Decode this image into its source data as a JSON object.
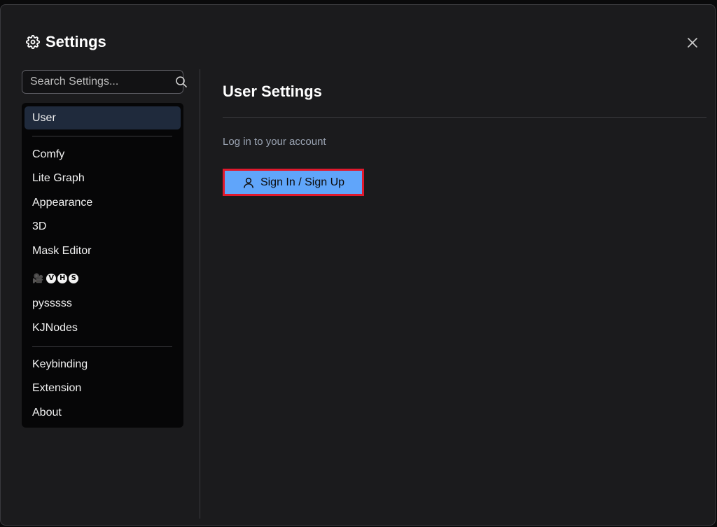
{
  "header": {
    "title": "Settings",
    "icon": "gear-icon",
    "close_icon": "close-icon"
  },
  "search": {
    "placeholder": "Search Settings...",
    "value": "",
    "icon": "search-icon"
  },
  "nav": {
    "items": [
      {
        "label": "User",
        "active": true
      },
      {
        "label": "Comfy"
      },
      {
        "label": "Lite Graph"
      },
      {
        "label": "Appearance"
      },
      {
        "label": "3D"
      },
      {
        "label": "Mask Editor"
      },
      {
        "label": "🎥VHS",
        "emoji": "🎥",
        "letters": [
          "V",
          "H",
          "S"
        ]
      },
      {
        "label": "pysssss"
      },
      {
        "label": "KJNodes"
      },
      {
        "label": "Keybinding"
      },
      {
        "label": "Extension"
      },
      {
        "label": "About"
      }
    ]
  },
  "panel": {
    "title": "User Settings",
    "login_prompt": "Log in to your account",
    "signin_label": "Sign In / Sign Up",
    "signin_icon": "user-icon"
  },
  "colors": {
    "accent": "#60a5fa",
    "highlight_border": "#e0192d",
    "active_nav": "#1f2a3c"
  }
}
